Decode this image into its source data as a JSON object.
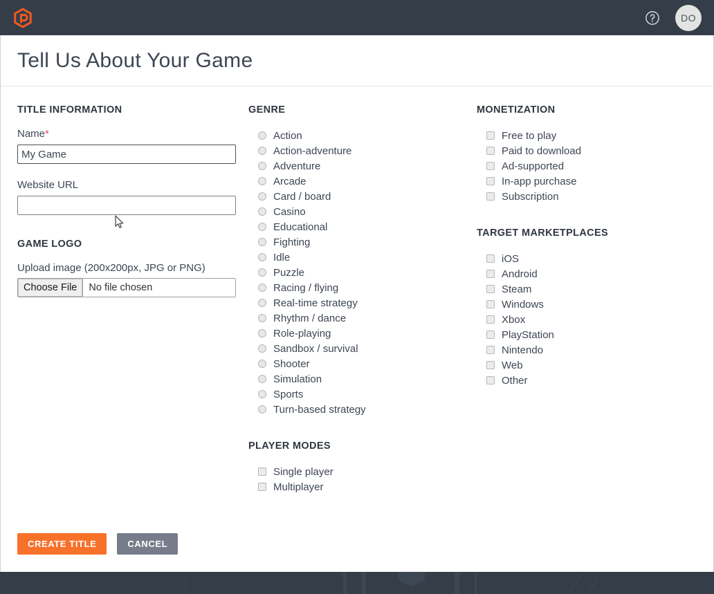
{
  "topbar": {
    "logo_icon": "hexagon-logo-icon",
    "help_icon": "help-circle-icon",
    "avatar_initials": "DO",
    "brand_color": "#f8712a",
    "bar_color": "#353d48"
  },
  "page": {
    "title": "Tell Us About Your Game"
  },
  "title_information": {
    "heading": "TITLE INFORMATION",
    "name_label": "Name",
    "name_required_marker": "*",
    "name_value": "My Game",
    "website_label": "Website URL",
    "website_value": "",
    "website_placeholder": ""
  },
  "game_logo": {
    "heading": "GAME LOGO",
    "upload_note": "Upload image (200x200px, JPG or PNG)",
    "choose_file_label": "Choose File",
    "file_status": "No file chosen"
  },
  "genre": {
    "heading": "GENRE",
    "options": [
      "Action",
      "Action-adventure",
      "Adventure",
      "Arcade",
      "Card / board",
      "Casino",
      "Educational",
      "Fighting",
      "Idle",
      "Puzzle",
      "Racing / flying",
      "Real-time strategy",
      "Rhythm / dance",
      "Role-playing",
      "Sandbox / survival",
      "Shooter",
      "Simulation",
      "Sports",
      "Turn-based strategy"
    ]
  },
  "player_modes": {
    "heading": "PLAYER MODES",
    "options": [
      "Single player",
      "Multiplayer"
    ]
  },
  "monetization": {
    "heading": "MONETIZATION",
    "options": [
      "Free to play",
      "Paid to download",
      "Ad-supported",
      "In-app purchase",
      "Subscription"
    ]
  },
  "target_marketplaces": {
    "heading": "TARGET MARKETPLACES",
    "options": [
      "iOS",
      "Android",
      "Steam",
      "Windows",
      "Xbox",
      "PlayStation",
      "Nintendo",
      "Web",
      "Other"
    ]
  },
  "actions": {
    "create_label": "CREATE TITLE",
    "cancel_label": "CANCEL",
    "create_color": "#f8712a",
    "cancel_color": "#767c8a"
  }
}
